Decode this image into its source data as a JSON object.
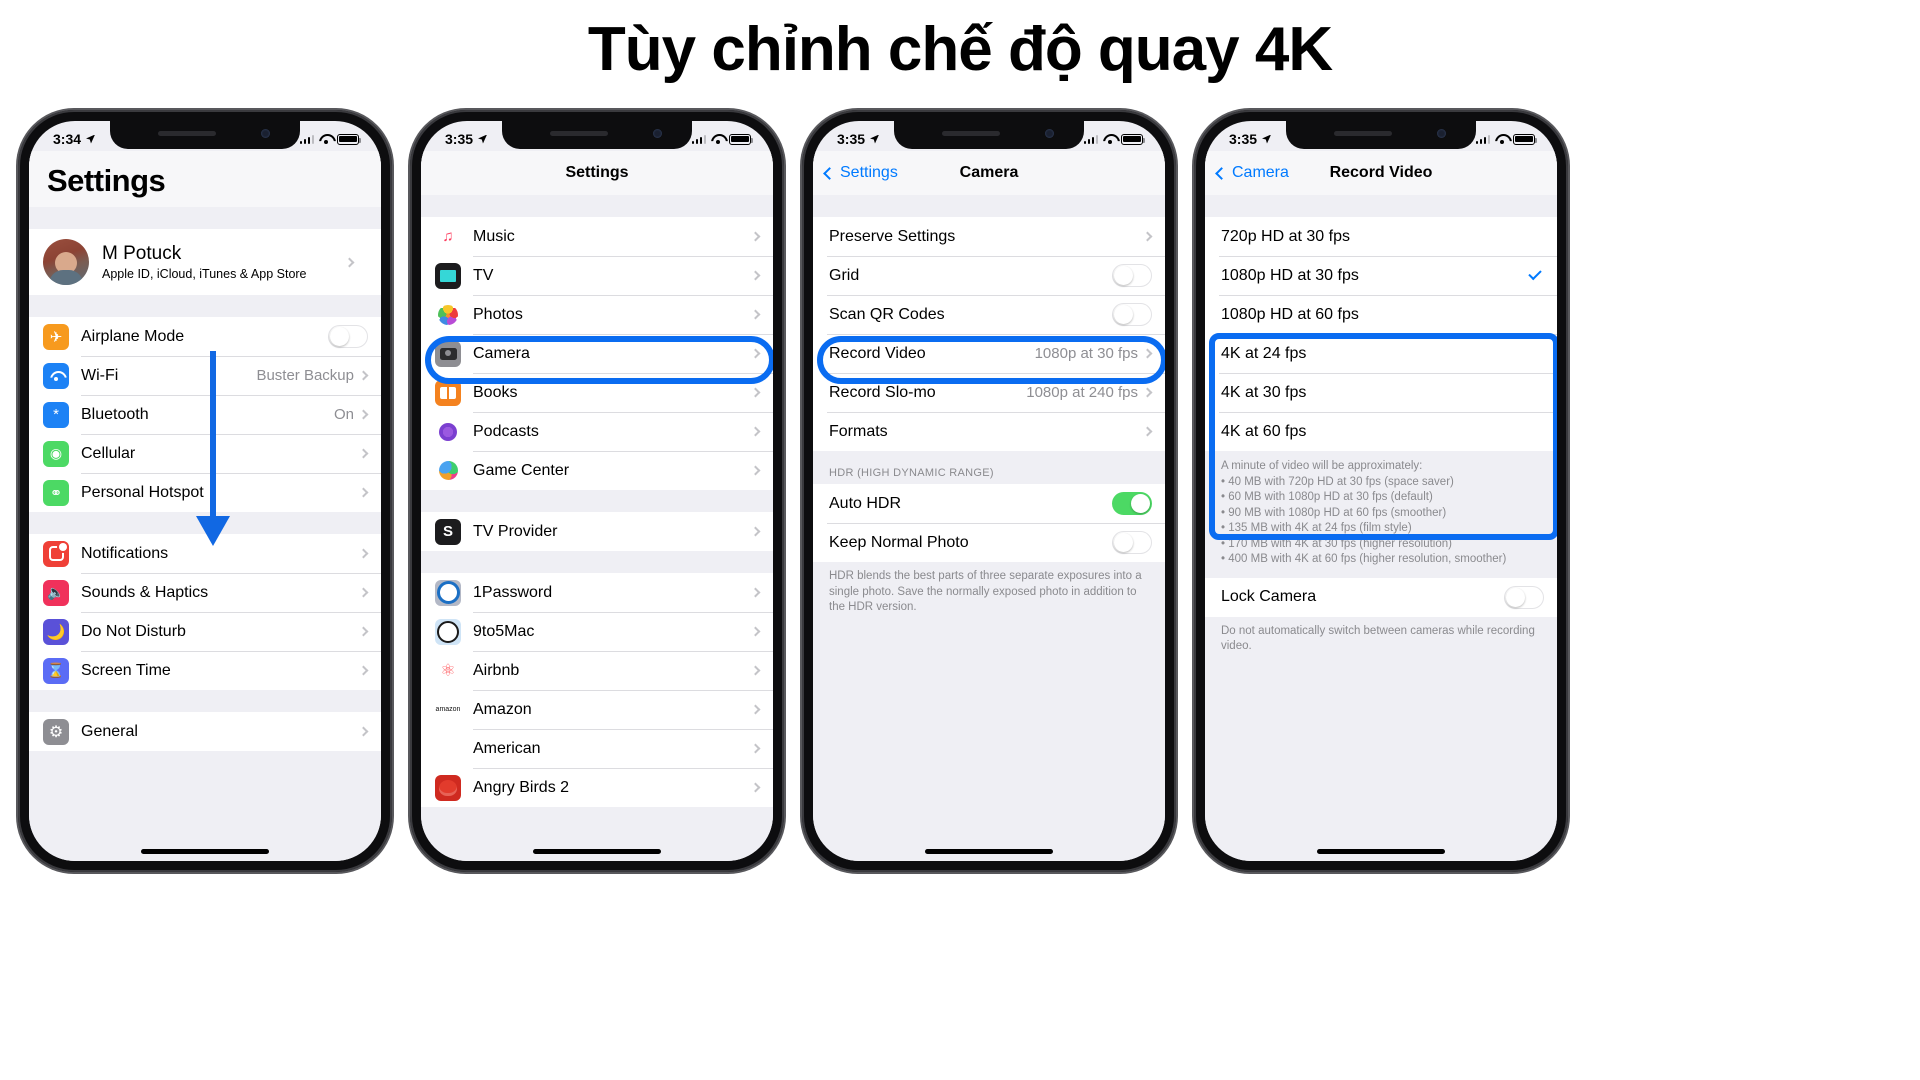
{
  "page": {
    "title": "Tùy chỉnh chế độ quay 4K"
  },
  "accent": "#0a6cf1",
  "phones": [
    {
      "id": "phone-1",
      "status": {
        "time": "3:34"
      },
      "nav": {
        "large_title": "Settings"
      },
      "profile": {
        "name": "M Potuck",
        "subtitle": "Apple ID, iCloud, iTunes & App Store"
      },
      "group_connectivity": [
        {
          "label": "Airplane Mode",
          "icon": "airplane-icon",
          "control": "toggle-off"
        },
        {
          "label": "Wi-Fi",
          "icon": "wifi-icon",
          "value": "Buster Backup",
          "control": "chevron"
        },
        {
          "label": "Bluetooth",
          "icon": "bluetooth-icon",
          "value": "On",
          "control": "chevron"
        },
        {
          "label": "Cellular",
          "icon": "cellular-icon",
          "value": "",
          "control": "chevron"
        },
        {
          "label": "Personal Hotspot",
          "icon": "hotspot-icon",
          "value": "",
          "control": "chevron"
        }
      ],
      "group_alerts": [
        {
          "label": "Notifications",
          "icon": "notifications-icon",
          "control": "chevron"
        },
        {
          "label": "Sounds & Haptics",
          "icon": "sounds-icon",
          "control": "chevron"
        },
        {
          "label": "Do Not Disturb",
          "icon": "moon-icon",
          "control": "chevron"
        },
        {
          "label": "Screen Time",
          "icon": "hourglass-icon",
          "control": "chevron"
        }
      ],
      "group_system": [
        {
          "label": "General",
          "icon": "gear-icon",
          "control": "chevron"
        }
      ]
    },
    {
      "id": "phone-2",
      "status": {
        "time": "3:35"
      },
      "nav": {
        "title": "Settings"
      },
      "group_apps": [
        {
          "label": "Music",
          "icon": "music-icon"
        },
        {
          "label": "TV",
          "icon": "tv-icon"
        },
        {
          "label": "Photos",
          "icon": "photos-icon"
        },
        {
          "label": "Camera",
          "icon": "camera-icon",
          "highlighted": true
        },
        {
          "label": "Books",
          "icon": "books-icon"
        },
        {
          "label": "Podcasts",
          "icon": "podcasts-icon"
        },
        {
          "label": "Game Center",
          "icon": "game-center-icon"
        }
      ],
      "group_provider": [
        {
          "label": "TV Provider",
          "icon": "tv-provider-icon"
        }
      ],
      "group_thirdparty": [
        {
          "label": "1Password",
          "icon": "1password-icon"
        },
        {
          "label": "9to5Mac",
          "icon": "9to5mac-icon"
        },
        {
          "label": "Airbnb",
          "icon": "airbnb-icon"
        },
        {
          "label": "Amazon",
          "icon": "amazon-icon"
        },
        {
          "label": "American",
          "icon": "american-icon"
        },
        {
          "label": "Angry Birds 2",
          "icon": "angry-birds-icon"
        }
      ]
    },
    {
      "id": "phone-3",
      "status": {
        "time": "3:35"
      },
      "nav": {
        "back_label": "Settings",
        "title": "Camera"
      },
      "group_main": [
        {
          "label": "Preserve Settings",
          "control": "chevron"
        },
        {
          "label": "Grid",
          "control": "toggle-off"
        },
        {
          "label": "Scan QR Codes",
          "control": "toggle-off"
        },
        {
          "label": "Record Video",
          "value": "1080p at 30 fps",
          "control": "chevron",
          "highlighted": true
        },
        {
          "label": "Record Slo-mo",
          "value": "1080p at 240 fps",
          "control": "chevron"
        },
        {
          "label": "Formats",
          "control": "chevron"
        }
      ],
      "hdr_section_header": "HDR (HIGH DYNAMIC RANGE)",
      "group_hdr": [
        {
          "label": "Auto HDR",
          "control": "toggle-on"
        },
        {
          "label": "Keep Normal Photo",
          "control": "toggle-off"
        }
      ],
      "hdr_footer": "HDR blends the best parts of three separate exposures into a single photo. Save the normally exposed photo in addition to the HDR version."
    },
    {
      "id": "phone-4",
      "status": {
        "time": "3:35"
      },
      "nav": {
        "back_label": "Camera",
        "title": "Record Video"
      },
      "group_resolutions": [
        {
          "label": "720p HD at 30 fps",
          "selected": false
        },
        {
          "label": "1080p HD at 30 fps",
          "selected": true
        },
        {
          "label": "1080p HD at 60 fps",
          "selected": false
        },
        {
          "label": "4K at 24 fps",
          "selected": false,
          "highlighted": true
        },
        {
          "label": "4K at 30 fps",
          "selected": false,
          "highlighted": true
        },
        {
          "label": "4K at 60 fps",
          "selected": false,
          "highlighted": true
        }
      ],
      "size_note_intro": "A minute of video will be approximately:",
      "size_note_bullets": [
        "40 MB with 720p HD at 30 fps (space saver)",
        "60 MB with 1080p HD at 30 fps (default)",
        "90 MB with 1080p HD at 60 fps (smoother)",
        "135 MB with 4K at 24 fps (film style)",
        "170 MB with 4K at 30 fps (higher resolution)",
        "400 MB with 4K at 60 fps (higher resolution, smoother)"
      ],
      "group_lock": [
        {
          "label": "Lock Camera",
          "control": "toggle-off"
        }
      ],
      "lock_footer": "Do not automatically switch between cameras while recording video."
    }
  ]
}
